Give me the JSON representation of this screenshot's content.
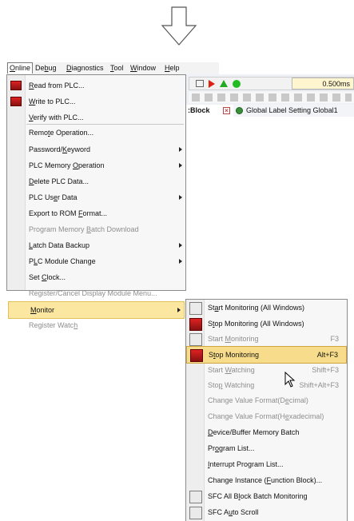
{
  "menubar": [
    {
      "label": "Online",
      "u": 0,
      "active": true
    },
    {
      "label": "Debug",
      "u": 2
    },
    {
      "label": "Diagnostics",
      "u": 0
    },
    {
      "label": "Tool",
      "u": 0
    },
    {
      "label": "Window",
      "u": 0
    },
    {
      "label": "Help",
      "u": 0
    }
  ],
  "toolbar": {
    "time": "0.500ms"
  },
  "tabs": [
    {
      "label": ":Block"
    },
    {
      "label": "Global Label Setting Global1"
    }
  ],
  "online_menu": [
    {
      "label": "Read from PLC...",
      "u": 0,
      "icon": "read-plc-icon"
    },
    {
      "label": "Write to PLC...",
      "u": 0,
      "icon": "write-plc-icon"
    },
    {
      "label": "Verify with PLC...",
      "u": 0
    },
    {
      "label": "Remote Operation...",
      "u": 4
    },
    {
      "label": "Password/Keyword",
      "u": 9,
      "sub": true
    },
    {
      "label": "PLC Memory Operation",
      "u": 11,
      "sub": true
    },
    {
      "label": "Delete PLC Data...",
      "u": 0
    },
    {
      "label": "PLC User Data",
      "u": 6,
      "sub": true
    },
    {
      "label": "Export to ROM Format...",
      "u": 14
    },
    {
      "label": "Program Memory Batch Download",
      "u": 15,
      "disabled": true
    },
    {
      "label": "Latch Data Backup",
      "u": 0,
      "sub": true
    },
    {
      "label": "PLC Module Change",
      "u": 1,
      "sub": true
    },
    {
      "label": "Set Clock...",
      "u": 4
    },
    {
      "label": "Register/Cancel Display Module Menu...",
      "disabled": true
    },
    {
      "label": "Monitor",
      "u": 0,
      "sub": true,
      "highlight": true
    },
    {
      "label": "Register Watch",
      "u": 13,
      "disabled": true
    }
  ],
  "monitor_menu": [
    {
      "label": "Start Monitoring (All Windows)",
      "u": 2,
      "icon": "start-all-monitor-icon"
    },
    {
      "label": "Stop Monitoring (All Windows)",
      "u": 1,
      "icon": "stop-all-monitor-icon"
    },
    {
      "label": "Start Monitoring",
      "u": 6,
      "shortcut": "F3",
      "disabled": true,
      "icon": "start-monitor-icon"
    },
    {
      "label": "Stop Monitoring",
      "u": 1,
      "shortcut": "Alt+F3",
      "highlight": true,
      "icon": "stop-monitor-icon"
    },
    {
      "label": "Start Watching",
      "u": 6,
      "shortcut": "Shift+F3",
      "disabled": true
    },
    {
      "label": "Stop Watching",
      "u": 3,
      "shortcut": "Shift+Alt+F3",
      "disabled": true
    },
    {
      "label": "Change Value Format(Decimal)",
      "u": 21,
      "disabled": true
    },
    {
      "label": "Change Value Format(Hexadecimal)",
      "u": 21,
      "disabled": true
    },
    {
      "label": "Device/Buffer Memory Batch",
      "u": 0
    },
    {
      "label": "Program List...",
      "u": 2
    },
    {
      "label": "Interrupt Program List...",
      "u": 0
    },
    {
      "label": "Change Instance (Function Block)...",
      "u": 17
    },
    {
      "label": "SFC All Block Batch Monitoring",
      "u": 9,
      "icon": "sfc-batch-icon"
    },
    {
      "label": "SFC Auto Scroll",
      "u": 5,
      "icon": "sfc-scroll-icon"
    }
  ]
}
